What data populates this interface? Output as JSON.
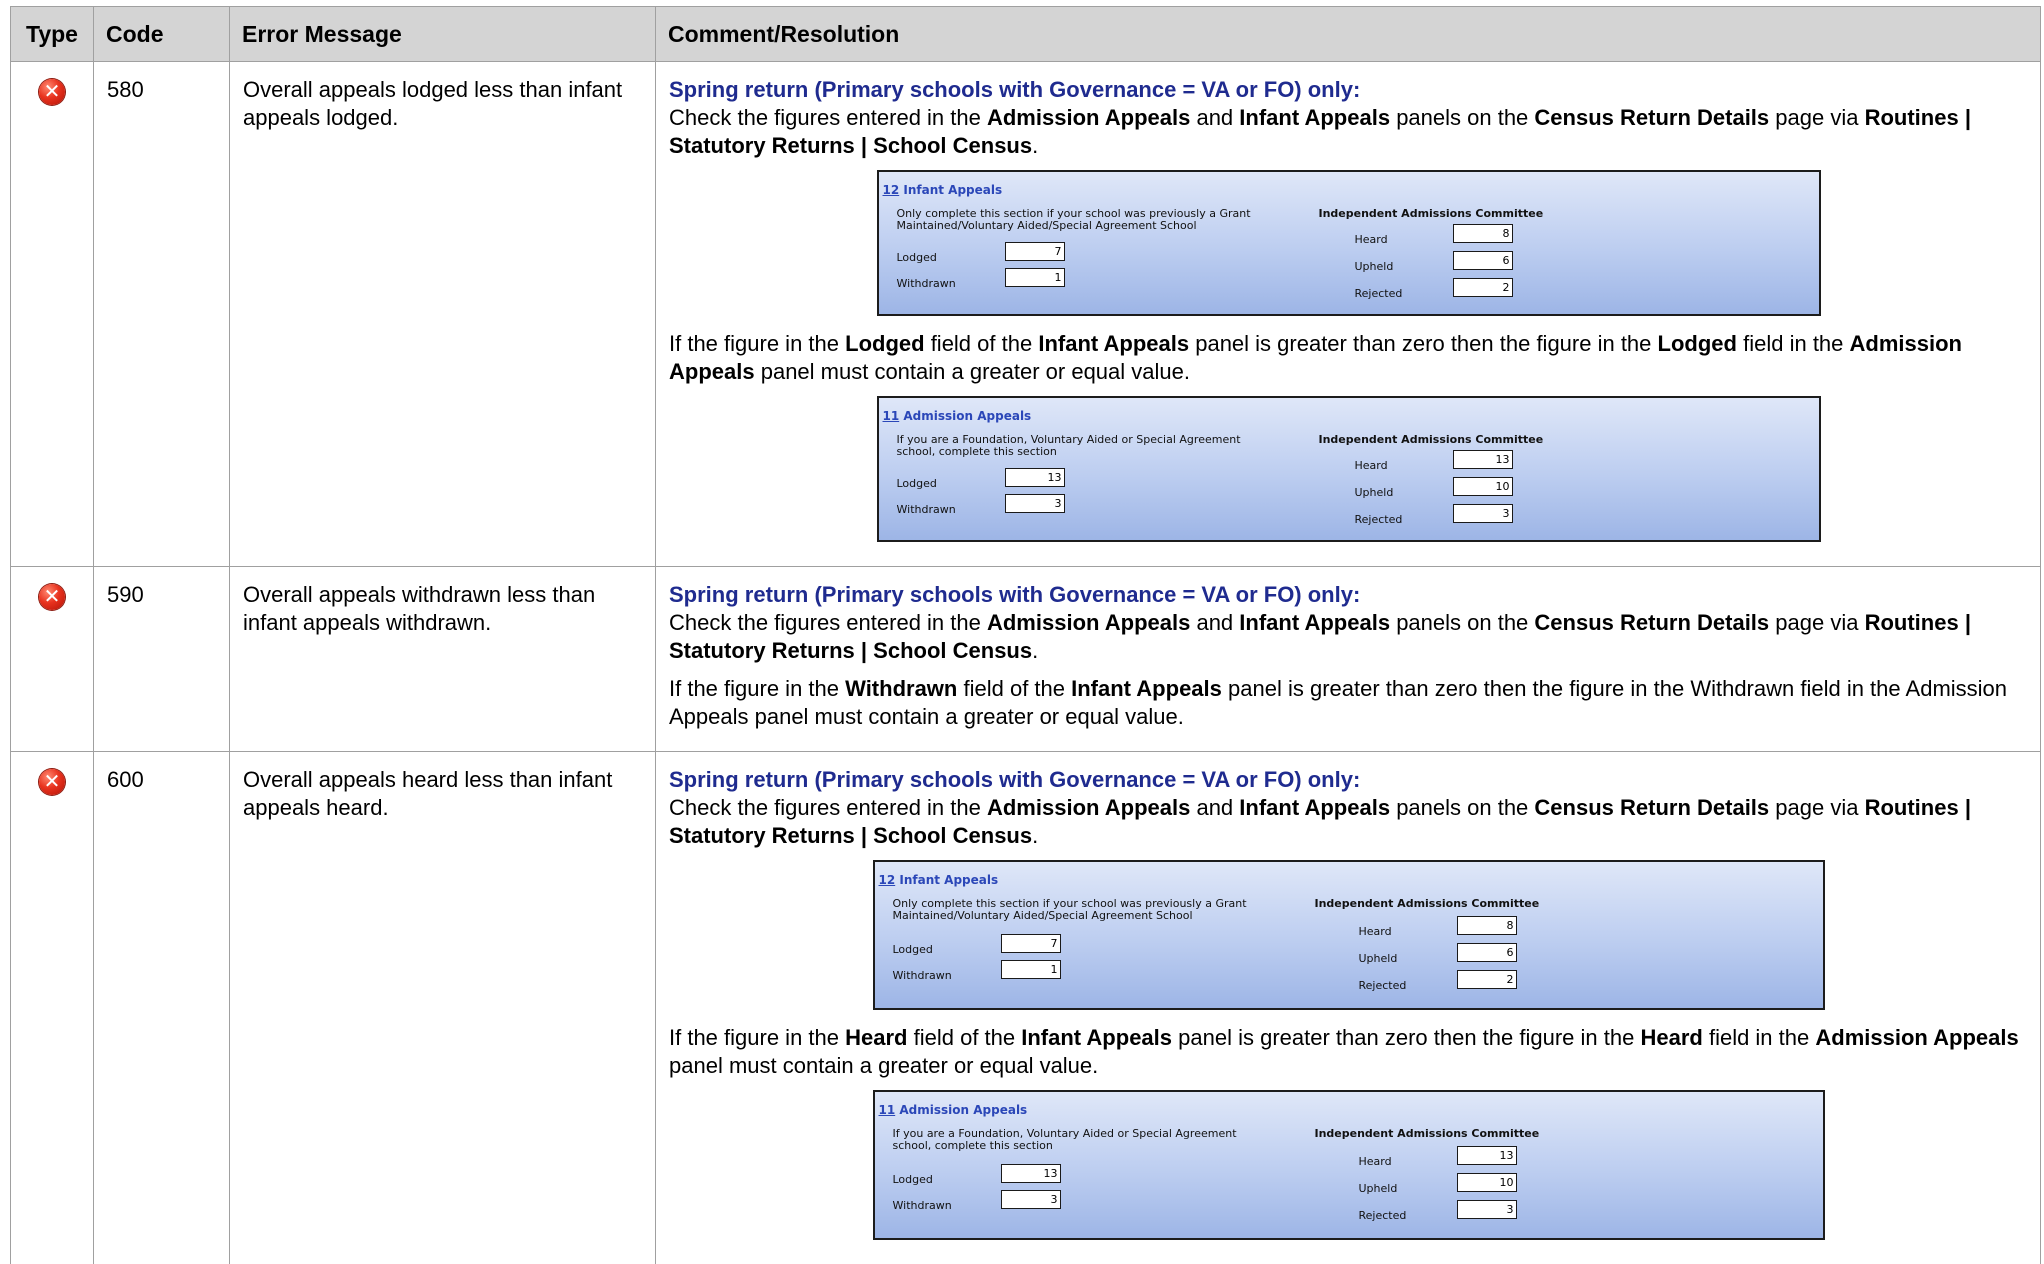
{
  "columns": {
    "type": "Type",
    "code": "Code",
    "message": "Error Message",
    "resolution": "Comment/Resolution"
  },
  "icon": "error-x-icon",
  "common": {
    "spring": "Spring return (Primary schools with Governance = VA or FO) only:",
    "check_pre": "Check the figures entered in the",
    "admission_appeals": "Admission Appeals",
    "and": "and",
    "infant_appeals": "Infant Appeals",
    "panels_on_the": "panels on the",
    "census_details": "Census Return Details",
    "page_via": "page via",
    "routine_path": "Routines | Statutory Returns | School Census",
    "period": ".",
    "if_figure": "If the figure in the",
    "field_of_the": "field of the",
    "panel_gt_zero": "panel is greater than zero then the figure in the",
    "field_in_the": "field in the",
    "panel_must": "panel must contain a greater or equal value.",
    "lodged": "Lodged",
    "withdrawn": "Withdrawn",
    "heard": "Heard",
    "rule_590_rest": "panel is greater than zero then the figure in the Withdrawn field in the Admission Appeals panel must contain a greater or equal value."
  },
  "rows": [
    {
      "code": "580",
      "message": "Overall appeals lodged less than infant appeals lodged."
    },
    {
      "code": "590",
      "message": "Overall appeals withdrawn less than infant appeals withdrawn."
    },
    {
      "code": "600",
      "message": "Overall appeals heard less than infant appeals heard."
    }
  ],
  "infant_panel": {
    "num": "12",
    "title": " Infant Appeals",
    "note": "Only complete this section if your school was previously a Grant Maintained/Voluntary Aided/Special Agreement School",
    "committee": "Independent Admissions Committee",
    "lodged_label": "Lodged",
    "lodged": "7",
    "withdrawn_label": "Withdrawn",
    "withdrawn": "1",
    "heard_label": "Heard",
    "heard": "8",
    "upheld_label": "Upheld",
    "upheld": "6",
    "rejected_label": "Rejected",
    "rejected": "2"
  },
  "admission_panel": {
    "num": "11",
    "title": " Admission Appeals",
    "note": "If you are a Foundation, Voluntary Aided or Special Agreement school, complete this section",
    "committee": "Independent Admissions Committee",
    "lodged_label": "Lodged",
    "lodged": "13",
    "withdrawn_label": "Withdrawn",
    "withdrawn": "3",
    "heard_label": "Heard",
    "heard": "13",
    "upheld_label": "Upheld",
    "upheld": "10",
    "rejected_label": "Rejected",
    "rejected": "3"
  }
}
